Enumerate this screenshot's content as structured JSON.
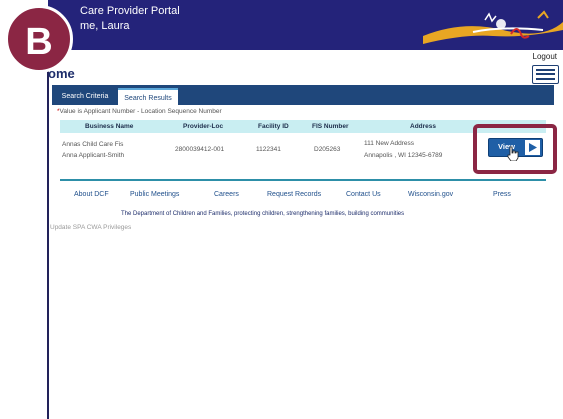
{
  "header": {
    "title": "Care Provider Portal",
    "welcome": "me, Laura"
  },
  "badge": {
    "letter": "B",
    "color": "#8b2644"
  },
  "logout_label": "Logout",
  "page_title": "ome",
  "tabs": [
    {
      "label": "Search Criteria",
      "active": false
    },
    {
      "label": "Search Results",
      "active": true
    }
  ],
  "results": {
    "note_asterisk": "*",
    "note": "Value is Applicant Number - Location Sequence Number",
    "columns": [
      "Business Name",
      "Provider-Loc",
      "Facility ID",
      "FIS Number",
      "Address"
    ],
    "rows": [
      {
        "business_name_line1": "Annas Child Care Fis",
        "business_name_line2": "Anna Applicant-Smith",
        "provider_loc": "2800039412-001",
        "facility_id": "1122341",
        "fis_number": "D205263",
        "address_line1": "111 New Address",
        "address_line2": "Annapolis , WI 12345-6789"
      }
    ],
    "view_button_label": "View"
  },
  "footer": {
    "links": [
      "About DCF",
      "Public Meetings",
      "Careers",
      "Request Records",
      "Contact Us",
      "Wisconsin.gov",
      "Press"
    ],
    "tagline": "The Department of Children and Families, protecting children, strengthening families, building communities"
  },
  "update_link": "Update SPA CWA Privileges",
  "colors": {
    "header_bg": "#24237a",
    "tab_bar": "#1f477b",
    "table_header": "#c9eef2",
    "view_button": "#1f5fa6",
    "highlight": "#8b2644",
    "footer_link": "#1f4f8b"
  }
}
